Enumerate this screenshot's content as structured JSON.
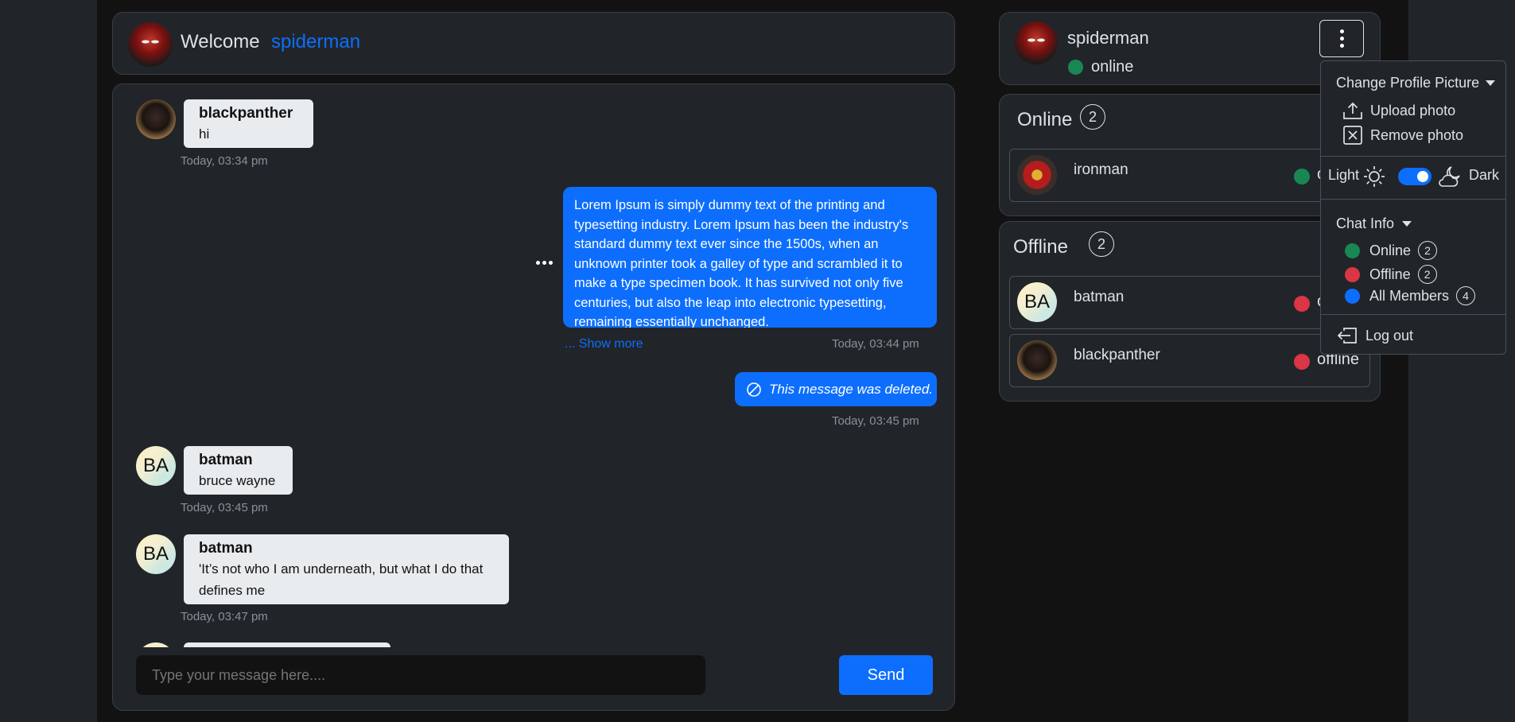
{
  "header": {
    "welcome": "Welcome",
    "username": "spiderman"
  },
  "messages": [
    {
      "sender": "blackpanther",
      "text": "hi",
      "time": "Today, 03:34 pm"
    },
    {
      "text": "Lorem Ipsum is simply dummy text of the printing and typesetting industry. Lorem Ipsum has been the industry's standard dummy text ever since the 1500s, when an unknown printer took a galley of type and scrambled it to make a type specimen book. It has survived not only five centuries, but also the leap into electronic typesetting, remaining essentially unchanged.",
      "show_more": "... Show more",
      "time": "Today, 03:44 pm"
    },
    {
      "text": "This message was deleted.",
      "time": "Today, 03:45 pm"
    },
    {
      "sender": "batman",
      "initials": "BA",
      "text": "bruce wayne",
      "time": "Today, 03:45 pm"
    },
    {
      "sender": "batman",
      "initials": "BA",
      "text": "'It’s not who I am underneath, but what I do that defines me",
      "time": "Today, 03:47 pm"
    }
  ],
  "composer": {
    "placeholder": "Type your message here....",
    "send_label": "Send"
  },
  "profile": {
    "name": "spiderman",
    "status": "online"
  },
  "online_section": {
    "title": "Online",
    "count": "2",
    "members": [
      {
        "name": "ironman",
        "status": "online"
      }
    ]
  },
  "offline_section": {
    "title": "Offline",
    "count": "2",
    "members": [
      {
        "name": "batman",
        "initials": "BA",
        "status": "offline"
      },
      {
        "name": "blackpanther",
        "status": "offline"
      }
    ]
  },
  "dropdown": {
    "change_picture": "Change Profile Picture",
    "upload": "Upload photo",
    "remove": "Remove photo",
    "light": "Light",
    "dark": "Dark",
    "theme_dark_on": true,
    "chat_info": "Chat Info",
    "info": [
      {
        "label": "Online",
        "count": "2",
        "color": "#198754"
      },
      {
        "label": "Offline",
        "count": "2",
        "color": "#dc3545"
      },
      {
        "label": "All Members",
        "count": "4",
        "color": "#0d6efd"
      }
    ],
    "logout": "Log out"
  },
  "colors": {
    "accent": "#0d6efd",
    "online": "#198754",
    "offline": "#dc3545"
  }
}
